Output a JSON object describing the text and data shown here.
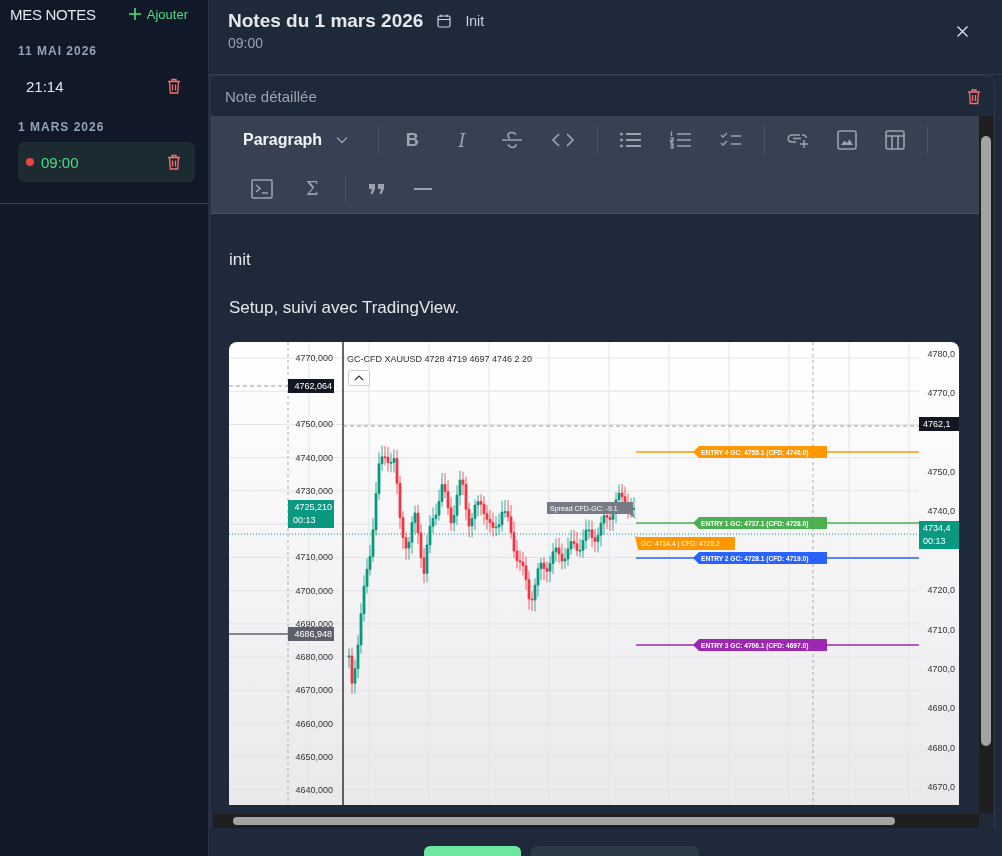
{
  "sidebar": {
    "title": "MES NOTES",
    "add_button": "Ajouter",
    "groups": [
      {
        "date": "11 MAI 2026",
        "notes": [
          {
            "time": "21:14",
            "selected": false,
            "unsaved": false
          }
        ]
      },
      {
        "date": "1 MARS 2026",
        "notes": [
          {
            "time": "09:00",
            "selected": true,
            "unsaved": true
          }
        ]
      }
    ]
  },
  "header": {
    "title": "Notes du 1 mars 2026",
    "tag": "Init",
    "subtitle": "09:00"
  },
  "card": {
    "title": "Note détaillée"
  },
  "toolbar": [
    {
      "kind": "dropdown",
      "label": "Paragraph"
    },
    {
      "kind": "separator"
    },
    {
      "kind": "bold",
      "label": "B"
    },
    {
      "kind": "italic",
      "label": "I"
    },
    {
      "kind": "strike"
    },
    {
      "kind": "code"
    },
    {
      "kind": "separator"
    },
    {
      "kind": "bullets"
    },
    {
      "kind": "numbered"
    },
    {
      "kind": "tasks"
    },
    {
      "kind": "separator"
    },
    {
      "kind": "link"
    },
    {
      "kind": "image"
    },
    {
      "kind": "table"
    },
    {
      "kind": "separator"
    },
    {
      "kind": "codeblock"
    },
    {
      "kind": "formula",
      "label": "Σ"
    },
    {
      "kind": "separator"
    },
    {
      "kind": "quote"
    },
    {
      "kind": "rule"
    }
  ],
  "content": {
    "paragraphs": [
      "init",
      "Setup, suivi avec TradingView."
    ],
    "image": {
      "legend": "GC-CFD XAUUSD 4728 4719 4697 4746 2 20",
      "left_axis": [
        "4770,000",
        "4750,000",
        "4740,000",
        "4730,000",
        "4710,000",
        "4700,000",
        "4690,000",
        "4680,000",
        "4670,000",
        "4660,000",
        "4650,000",
        "4640,000"
      ],
      "right_axis": [
        "4780,0",
        "4770,0",
        "4750,0",
        "4740,0",
        "4720,0",
        "4710,0",
        "4700,0",
        "4690,0",
        "4680,0",
        "4670,0"
      ],
      "left_badges": [
        {
          "kind": "dark",
          "text": "4762,064"
        },
        {
          "kind": "live",
          "text": "4725,210",
          "sub": "00:13"
        },
        {
          "kind": "grey",
          "text": "4686,948"
        }
      ],
      "right_badges": [
        {
          "kind": "dark",
          "text": "4762,1"
        },
        {
          "kind": "live",
          "text": "4734,4",
          "sub": "00:13"
        }
      ],
      "entries": [
        {
          "label": "ENTRY 4 GC: 4755.1 (CFD: 4746.0)",
          "color": "#ff9800"
        },
        {
          "label": "ENTRY 1 GC: 4737.1 (CFD: 4728.0)",
          "color": "#4caf50"
        },
        {
          "label": "ENTRY 2 GC: 4728.1 (CFD: 4719.0)",
          "color": "#2962ff"
        },
        {
          "label": "ENTRY 3 GC: 4706.1 (CFD: 4697.0)",
          "color": "#9c27b0"
        }
      ],
      "price_tag": "GC: 4734.4 | CFD: 4725.2",
      "tooltip": "Spread CFD-GC: -9.1"
    }
  }
}
